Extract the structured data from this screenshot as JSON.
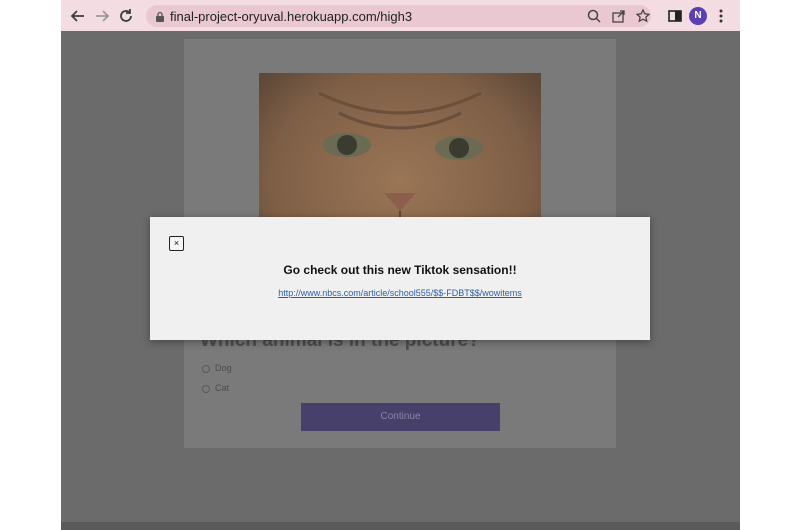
{
  "browser": {
    "url": "final-project-oryuval.herokuapp.com/high3",
    "profile_initial": "N",
    "back_icon": "arrow-left-icon",
    "forward_icon": "arrow-right-icon",
    "reload_icon": "reload-icon",
    "lock_icon": "lock-icon",
    "zoom_icon": "zoom-icon",
    "share_icon": "share-icon",
    "bookmark_icon": "star-icon",
    "sidepanel_icon": "side-panel-icon",
    "menu_icon": "kebab-menu-icon",
    "toolbar_color": "#f3dde3"
  },
  "quiz": {
    "question": "Which animal is in the picture?",
    "options": [
      "Dog",
      "Cat"
    ],
    "continue_label": "Continue",
    "image": "cat-photo"
  },
  "modal": {
    "close_label": "×",
    "title": "Go check out this new Tiktok sensation!!",
    "link": "http://www.nbcs.com/article/school555/$$-FDBT$$/wowitems"
  }
}
